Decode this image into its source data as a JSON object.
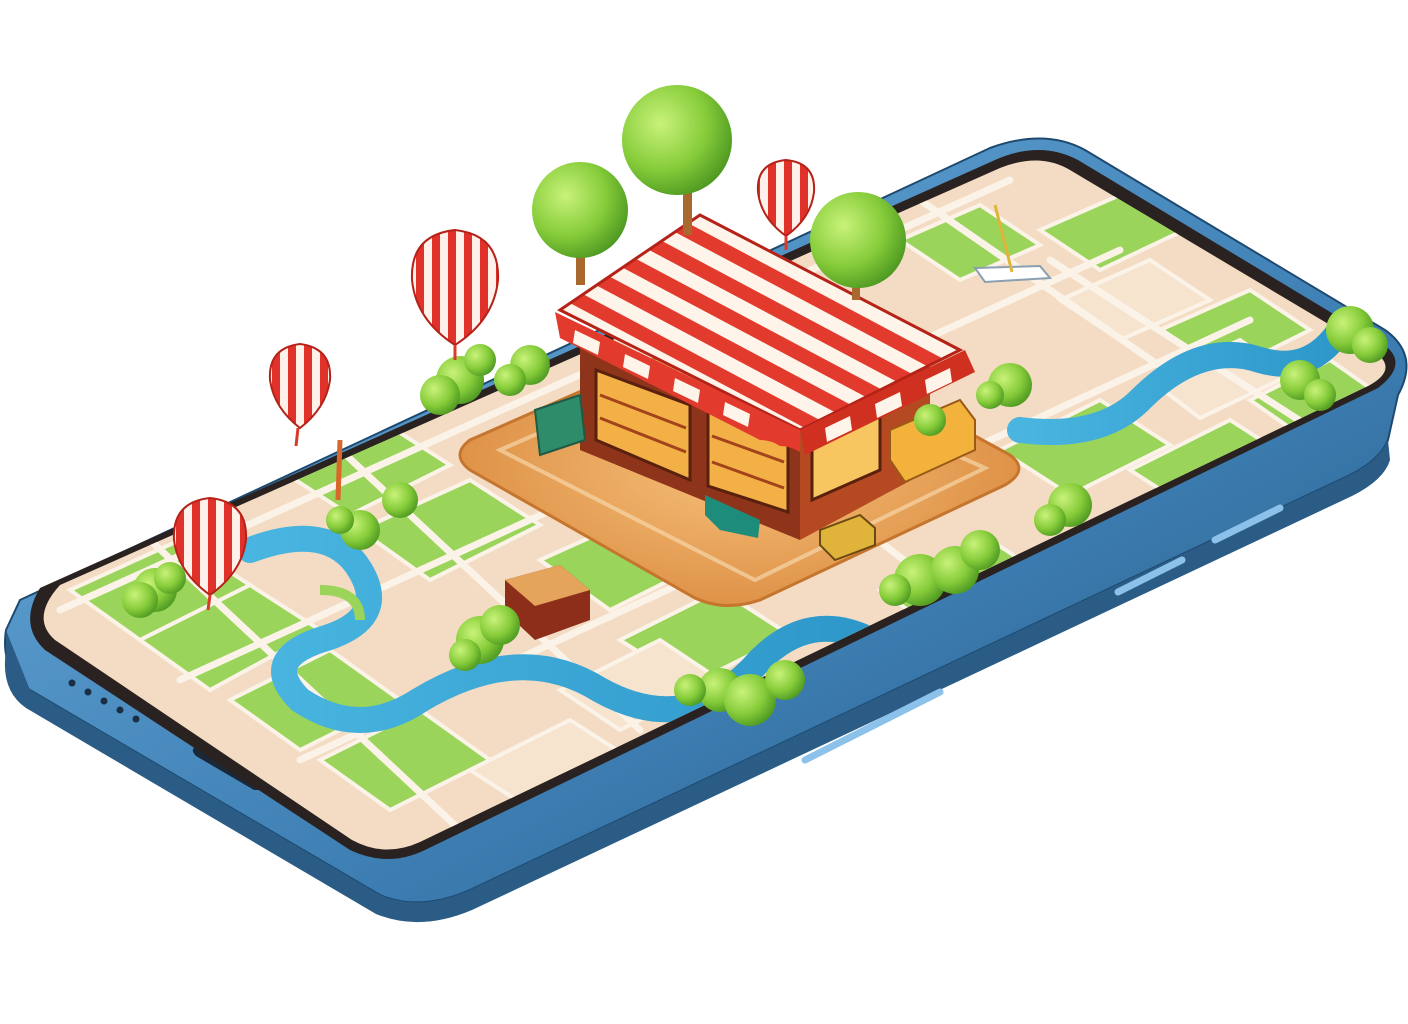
{
  "scene": {
    "subject": "isometric-smartphone-map-illustration",
    "colors": {
      "background": "#ffffff",
      "phone_body": "#4f8fc4",
      "phone_edge": "#2c5f8a",
      "bezel": "#2a2220",
      "map_base": "#f3dcc3",
      "park": "#9bd45a",
      "river": "#3fa9d6",
      "road": "#fbf3e8",
      "plaza": "#e9a65a",
      "awning_red": "#e23b2e",
      "awning_white": "#fff4ea",
      "shop_wall": "#9a3a1c",
      "tree": "#7cc83a",
      "trunk": "#a8682e"
    },
    "icons": [
      "balloon-pin-icon",
      "shop-icon",
      "tree-icon",
      "boat-icon",
      "car-icon"
    ]
  }
}
